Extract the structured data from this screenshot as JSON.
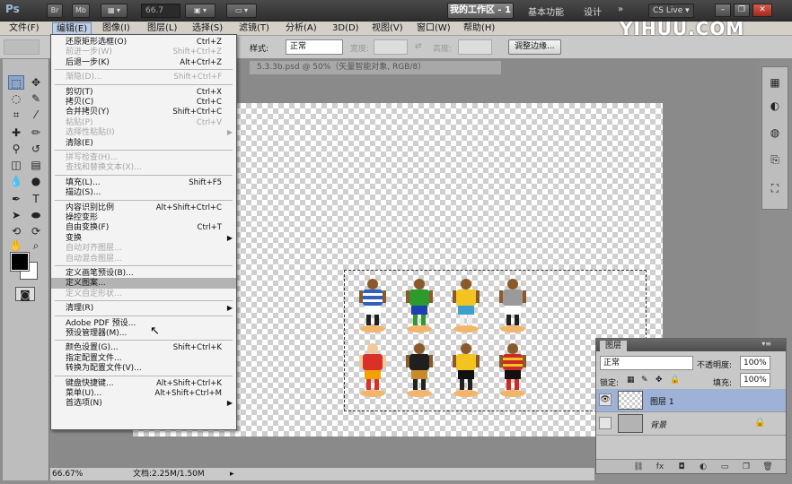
{
  "app": {
    "logo": "Ps",
    "zoom": "66.7",
    "workspace": "我的工作区 - 1",
    "workspace_links": [
      "基本功能",
      "设计",
      "»"
    ],
    "cs_live": "CS Live ▾"
  },
  "brand": "YIHUU.COM",
  "menubar": [
    "文件(F)",
    "编辑(E)",
    "图像(I)",
    "图层(L)",
    "选择(S)",
    "滤镜(T)",
    "分析(A)",
    "3D(D)",
    "视图(V)",
    "窗口(W)",
    "帮助(H)"
  ],
  "options": {
    "style_label": "样式:",
    "style_value": "正常",
    "width_label": "宽度:",
    "height_label": "高度:",
    "refine_edge": "调整边缘..."
  },
  "document": {
    "tab": "5.3.3b.psd @ 50%（矢量智能对象, RGB/8）",
    "zoom": "66.67%",
    "doc_info": "文档:2.25M/1.50M"
  },
  "players": [
    {
      "shirt": "#2f5fbf",
      "shorts": "#ffffff"
    },
    {
      "shirt": "#2c9a2c",
      "shorts": "#1d3fb0"
    },
    {
      "shirt": "#f3c31f",
      "shorts": "#3aa0cf"
    },
    {
      "shirt": "#9a9a9a",
      "shorts": "#ffffff"
    },
    {
      "shirt": "#d93028",
      "shorts": "#f2a100"
    },
    {
      "shirt": "#1f1f1f",
      "shorts": "#c98a2a"
    },
    {
      "shirt": "#f3c31f",
      "shorts": "#111111"
    },
    {
      "shirt": "#cc2a26",
      "shorts": "#111111"
    }
  ],
  "edit_menu": [
    {
      "label": "还原矩形选框(O)",
      "shortcut": "Ctrl+Z",
      "disabled": false
    },
    {
      "label": "前进一步(W)",
      "shortcut": "Shift+Ctrl+Z",
      "disabled": true
    },
    {
      "label": "后退一步(K)",
      "shortcut": "Alt+Ctrl+Z",
      "disabled": false
    },
    {
      "sep": true
    },
    {
      "label": "渐隐(D)...",
      "shortcut": "Shift+Ctrl+F",
      "disabled": true
    },
    {
      "sep": true
    },
    {
      "label": "剪切(T)",
      "shortcut": "Ctrl+X",
      "disabled": false
    },
    {
      "label": "拷贝(C)",
      "shortcut": "Ctrl+C",
      "disabled": false
    },
    {
      "label": "合并拷贝(Y)",
      "shortcut": "Shift+Ctrl+C",
      "disabled": false
    },
    {
      "label": "粘贴(P)",
      "shortcut": "Ctrl+V",
      "disabled": true
    },
    {
      "label": "选择性粘贴(I)",
      "shortcut": "",
      "disabled": true,
      "submenu": true
    },
    {
      "label": "清除(E)",
      "shortcut": "",
      "disabled": false
    },
    {
      "sep": true
    },
    {
      "label": "拼写检查(H)...",
      "shortcut": "",
      "disabled": true
    },
    {
      "label": "查找和替换文本(X)...",
      "shortcut": "",
      "disabled": true
    },
    {
      "sep": true
    },
    {
      "label": "填充(L)...",
      "shortcut": "Shift+F5",
      "disabled": false
    },
    {
      "label": "描边(S)...",
      "shortcut": "",
      "disabled": false
    },
    {
      "sep": true
    },
    {
      "label": "内容识别比例",
      "shortcut": "Alt+Shift+Ctrl+C",
      "disabled": false
    },
    {
      "label": "操控变形",
      "shortcut": "",
      "disabled": false
    },
    {
      "label": "自由变换(F)",
      "shortcut": "Ctrl+T",
      "disabled": false
    },
    {
      "label": "变换",
      "shortcut": "",
      "disabled": false,
      "submenu": true
    },
    {
      "label": "自动对齐图层...",
      "shortcut": "",
      "disabled": true
    },
    {
      "label": "自动混合图层...",
      "shortcut": "",
      "disabled": true
    },
    {
      "sep": true
    },
    {
      "label": "定义画笔预设(B)...",
      "shortcut": "",
      "disabled": false
    },
    {
      "label": "定义图案...",
      "shortcut": "",
      "disabled": false,
      "highlight": true
    },
    {
      "label": "定义自定形状...",
      "shortcut": "",
      "disabled": true
    },
    {
      "sep": true
    },
    {
      "label": "清理(R)",
      "shortcut": "",
      "disabled": false,
      "submenu": true
    },
    {
      "sep": true
    },
    {
      "label": "Adobe PDF 预设...",
      "shortcut": "",
      "disabled": false
    },
    {
      "label": "预设管理器(M)...",
      "shortcut": "",
      "disabled": false
    },
    {
      "sep": true
    },
    {
      "label": "颜色设置(G)...",
      "shortcut": "Shift+Ctrl+K",
      "disabled": false
    },
    {
      "label": "指定配置文件...",
      "shortcut": "",
      "disabled": false
    },
    {
      "label": "转换为配置文件(V)...",
      "shortcut": "",
      "disabled": false
    },
    {
      "sep": true
    },
    {
      "label": "键盘快捷键...",
      "shortcut": "Alt+Shift+Ctrl+K",
      "disabled": false
    },
    {
      "label": "菜单(U)...",
      "shortcut": "Alt+Shift+Ctrl+M",
      "disabled": false
    },
    {
      "label": "首选项(N)",
      "shortcut": "",
      "disabled": false,
      "submenu": true
    }
  ],
  "layers_panel": {
    "tab": "图层",
    "blend_mode": "正常",
    "opacity_label": "不透明度:",
    "opacity": "100%",
    "lock_label": "锁定:",
    "fill_label": "填充:",
    "fill": "100%",
    "layers": [
      {
        "name": "图层 1",
        "selected": true,
        "visible": true
      },
      {
        "name": "背景",
        "selected": false,
        "visible": false
      }
    ]
  }
}
